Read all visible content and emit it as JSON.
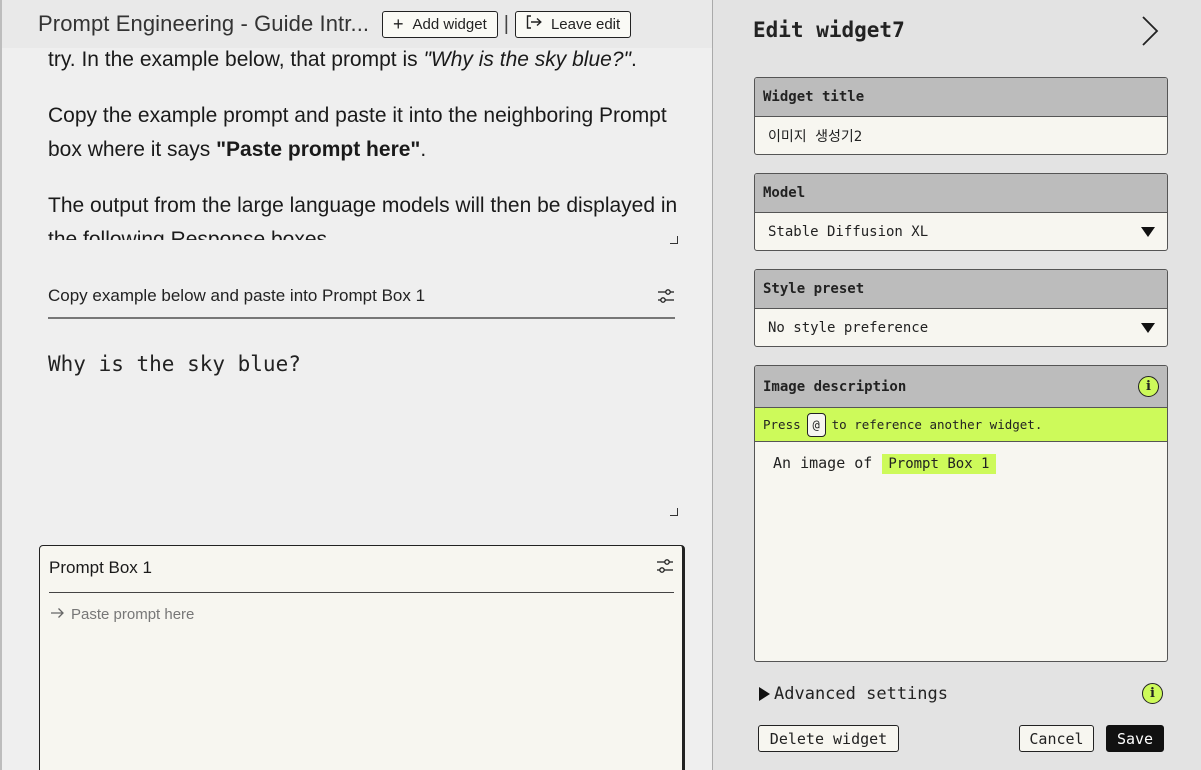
{
  "topbar": {
    "doc_title": "Prompt Engineering - Guide Intr...",
    "add_widget_label": "Add widget",
    "leave_edit_label": "Leave edit",
    "separator": "|"
  },
  "intro_text": {
    "p1_start": "try. In the example below, that prompt is ",
    "p1_italic": "\"Why is the sky blue?\"",
    "p1_end": ".",
    "p2_start": "Copy the example prompt and paste it into the neighboring Prompt box where it says ",
    "p2_bold": "\"Paste prompt here\"",
    "p2_end": ".",
    "p3": "The output from the large language models will then be displayed in the following Response boxes."
  },
  "example_widget": {
    "title": "Copy example below and paste into Prompt Box 1",
    "body": "Why is the sky blue?"
  },
  "prompt_box": {
    "title": "Prompt Box 1",
    "placeholder": "Paste prompt here"
  },
  "editor": {
    "title": "Edit widget7",
    "widget_title_label": "Widget title",
    "widget_title_value": "이미지 생성기2",
    "model_label": "Model",
    "model_value": "Stable Diffusion XL",
    "style_label": "Style preset",
    "style_value": "No style preference",
    "description_label": "Image description",
    "hint_press": "Press",
    "hint_key": "@",
    "hint_rest": "to reference another widget.",
    "description_text": "An image of",
    "description_ref": "Prompt Box 1",
    "advanced_label": "Advanced settings",
    "info_glyph": "i",
    "delete_label": "Delete widget",
    "cancel_label": "Cancel",
    "save_label": "Save"
  },
  "colors": {
    "accent_lime": "#cdfa5a",
    "panel_bg": "#e3e3e3",
    "field_label_bg": "#bcbcbc",
    "save_bg": "#111111"
  },
  "icons": [
    "plus-icon",
    "leave-edit-icon",
    "settings-sliders-icon",
    "arrow-right-icon",
    "chevron-right-icon",
    "dropdown-caret-icon",
    "info-icon",
    "triangle-right-icon"
  ]
}
